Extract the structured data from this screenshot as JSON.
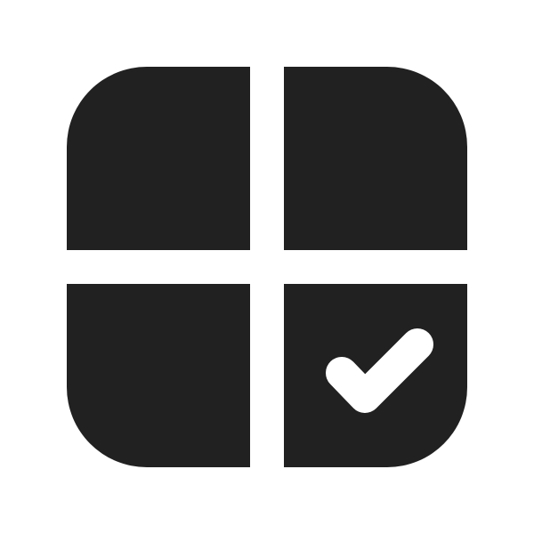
{
  "icon": {
    "name": "grid-check-icon",
    "colors": {
      "background": "#ffffff",
      "foreground": "#212121",
      "check": "#ffffff"
    }
  }
}
